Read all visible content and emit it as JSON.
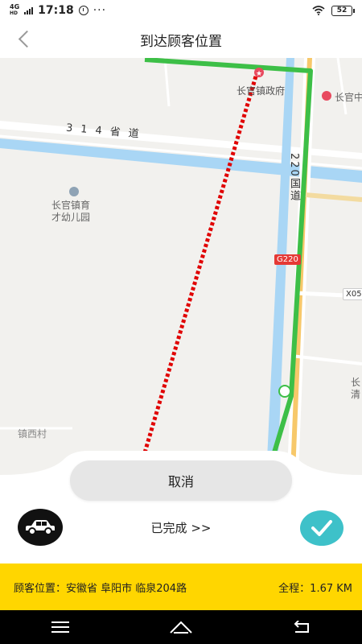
{
  "status_bar": {
    "network": "4G",
    "network_sub": "HD",
    "time": "17:18",
    "more": "···",
    "battery": "52"
  },
  "header": {
    "title": "到达顾客位置"
  },
  "map": {
    "labels": {
      "road_314": "314省道",
      "road_220": "220国道",
      "poi_gov": "长官镇政府",
      "poi_right": "长官中",
      "poi_school_1": "长官镇育",
      "poi_school_2": "才幼儿园",
      "village_west": "镇西村",
      "village_partial": "村",
      "badge_g220": "G220",
      "badge_x05": "X05",
      "edge_text_1": "长",
      "edge_text_2": "清"
    }
  },
  "bottom": {
    "cancel_label": "取消",
    "done_label": "已完成  >>"
  },
  "info": {
    "address": "顾客位置：安徽省 阜阳市  临泉204路",
    "distance": "全程：1.67 KM"
  },
  "colors": {
    "accent_yellow": "#ffd600",
    "check_teal": "#3ec1c9",
    "route_red": "#e00000",
    "route_green": "#3dbf47"
  }
}
